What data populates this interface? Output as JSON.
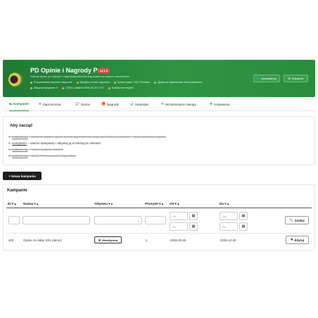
{
  "header": {
    "title": "PD Opinie i Nagrody Pro",
    "version": "v1.1.0",
    "subtitle": "Zbieraj opinie po zakupie i nagradzaj klientów kuponami na kolejne zamówienie.",
    "status_line1": [
      "Przyznawanie kuponów: włączone",
      "Wysyłka e-maili: włączona",
      "System opinii: SQIT Reviews",
      "Zgoda na zaproszenia: oferta partnerów"
    ],
    "status_line2": [
      "Aktywne kampanie: 0",
      "CRON: ostatnio 2026-09-26 17:07",
      "Kolejka bez błędów"
    ],
    "btn_prestadev": "prestadev.pl",
    "btn_support": "Wsparcie",
    "colors": {
      "accent": "#25873a",
      "header_bg": "#2e9442",
      "version_badge": "#d9534f",
      "status_dot": "#f0ad4e"
    }
  },
  "tabs": [
    {
      "label": "Kampanie",
      "icon": "campaign-icon"
    },
    {
      "label": "Zaproszenia",
      "icon": "envelope-icon"
    },
    {
      "label": "Opinie",
      "icon": "comments-icon"
    },
    {
      "label": "Nagrody",
      "icon": "gift-icon"
    },
    {
      "label": "Statystyki",
      "icon": "bar-chart-icon"
    },
    {
      "label": "Wcześniejsze zakupy",
      "icon": "history-icon"
    },
    {
      "label": "Ustawienia",
      "icon": "gears-icon"
    }
  ],
  "getting_started": {
    "title": "Aby zacząć",
    "steps": [
      {
        "num": "1.",
        "link": "Ustawienia",
        "text": " – wybierz system opinii, a pola zaproszenia mają wychodzić w mailach – także podstawy zgody."
      },
      {
        "num": "2.",
        "link": "Kampanie",
        "text": " – utwórz kampanię i aktywuj ją w bieżącym okresie."
      },
      {
        "num": "3.",
        "link": "Ustawienia",
        "text": " – ustaw zadanie CRON."
      },
      {
        "num": "4.",
        "link": "Ustawienia",
        "text": " – ukryj „Przyznawanie kuponów\"."
      }
    ]
  },
  "new_campaign_label": "+ Nowa kampania",
  "campaigns": {
    "title": "Kampanie",
    "columns": [
      "ID ▾ ▴",
      "Nazwa ▾ ▴",
      "Aktywna ▾ ▴",
      "Priorytet ▾ ▴",
      "Od ▾ ▴",
      "Do ▾ ▴"
    ],
    "filter": {
      "active_select": "-",
      "from_placeholder": "Od",
      "to_placeholder": "Do",
      "search_label": "Szukaj"
    },
    "rows": [
      {
        "id": "400",
        "name": "Opinie za rabat 10% (demo)",
        "active": "Nieaktywna",
        "priority": "1",
        "from": "2026-09-26",
        "to": "2026-12-20",
        "edit": "Edytuj"
      }
    ]
  }
}
